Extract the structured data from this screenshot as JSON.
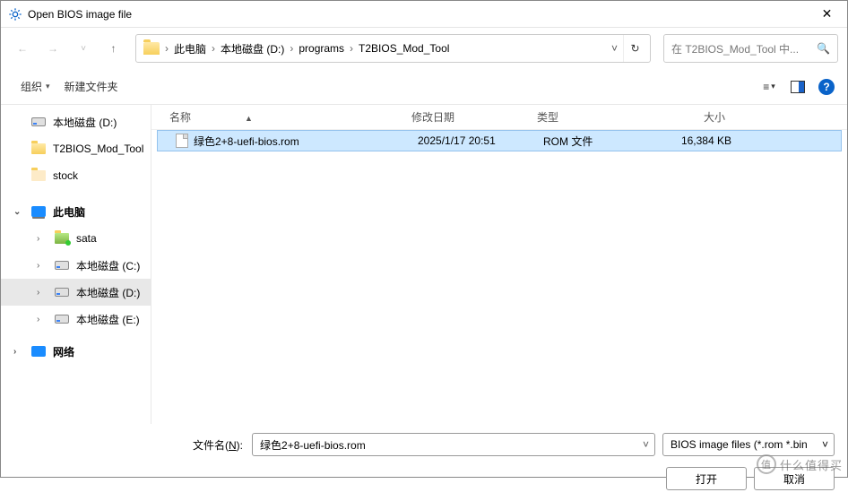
{
  "window": {
    "title": "Open BIOS image file"
  },
  "breadcrumb": [
    "此电脑",
    "本地磁盘 (D:)",
    "programs",
    "T2BIOS_Mod_Tool"
  ],
  "search": {
    "placeholder": "在 T2BIOS_Mod_Tool 中..."
  },
  "toolbar": {
    "organize": "组织",
    "newfolder": "新建文件夹"
  },
  "sidebar": {
    "quick": [
      {
        "label": "本地磁盘 (D:)",
        "icon": "disk"
      },
      {
        "label": "T2BIOS_Mod_Tool",
        "icon": "folder"
      },
      {
        "label": "stock",
        "icon": "folder-empty"
      }
    ],
    "pc_label": "此电脑",
    "drives": [
      {
        "label": "sata",
        "icon": "folder-green"
      },
      {
        "label": "本地磁盘 (C:)",
        "icon": "disk"
      },
      {
        "label": "本地磁盘 (D:)",
        "icon": "disk",
        "selected": true
      },
      {
        "label": "本地磁盘 (E:)",
        "icon": "disk"
      }
    ],
    "network_label": "网络"
  },
  "columns": {
    "name": "名称",
    "date": "修改日期",
    "type": "类型",
    "size": "大小"
  },
  "files": [
    {
      "name": "绿色2+8-uefi-bios.rom",
      "date": "2025/1/17 20:51",
      "type": "ROM 文件",
      "size": "16,384 KB"
    }
  ],
  "footer": {
    "filename_label_pre": "文件名(",
    "filename_label_u": "N",
    "filename_label_post": "):",
    "filename_value": "绿色2+8-uefi-bios.rom",
    "filter": "BIOS image files (*.rom *.bin",
    "open": "打开",
    "cancel": "取消"
  },
  "watermark": "什么值得买"
}
